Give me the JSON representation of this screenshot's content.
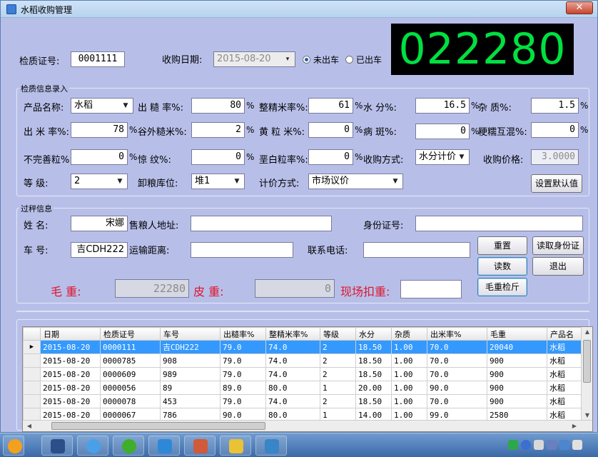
{
  "window": {
    "title": "水稻收购管理",
    "close_label": "✕"
  },
  "header": {
    "cert_label": "检质证号:",
    "cert_value": "0001111",
    "date_label": "收购日期:",
    "date_value": "2015-08-20",
    "radio_unshipped": "未出车",
    "radio_shipped": "已出车",
    "big_display": "022280"
  },
  "quality": {
    "group_title": "检质信息录入",
    "product_label": "产品名称:",
    "product_value": "水稻",
    "chucao_label": "出 糙 率%:",
    "chucao_value": "80",
    "zhengjing_label": "整精米率%:",
    "zhengjing_value": "61",
    "shuifen_label": "水     分%:",
    "shuifen_value": "16.5",
    "zazhi_label": "杂     质%:",
    "zazhi_value": "1.5",
    "chumi_label": "出 米 率%:",
    "chumi_value": "78",
    "guwai_label": "谷外糙米%:",
    "guwai_value": "2",
    "huangli_label": "黄 粒 米%:",
    "huangli_value": "0",
    "bingban_label": "病     斑%:",
    "bingban_value": "0",
    "genghun_label": "粳糯互混%:",
    "genghun_value": "0",
    "buwanshan_label": "不完善粒%:",
    "buwanshan_value": "0",
    "jingwen_label": "惊     纹%:",
    "jingwen_value": "0",
    "ebai_label": "垩白粒率%:",
    "ebai_value": "0",
    "method_label": "收购方式:",
    "method_value": "水分计价",
    "price_label": "收购价格:",
    "price_value": "3.0000",
    "grade_label": "等     级:",
    "grade_value": "2",
    "unload_label": "卸粮库位:",
    "unload_value": "堆1",
    "pricing_label": "计价方式:",
    "pricing_value": "市场议价",
    "default_button": "设置默认值",
    "percent": "%"
  },
  "weigh": {
    "group_title": "过秤信息",
    "name_label": "姓     名:",
    "name_value": "宋娜",
    "address_label": "售粮人地址:",
    "address_value": "",
    "id_label": "身份证号:",
    "id_value": "",
    "plate_label": "车     号:",
    "plate_value": "吉CDH222",
    "distance_label": "运输距离:",
    "distance_value": "",
    "phone_label": "联系电话:",
    "phone_value": "",
    "reset_button": "重置",
    "read_id_button": "读取身份证",
    "read_button": "读数",
    "exit_button": "退出",
    "gross_label": "毛     重:",
    "gross_value": "22280",
    "tare_label": "皮     重:",
    "tare_value": "0",
    "deduct_label": "现场扣重:",
    "deduct_value": "",
    "gross_check_button": "毛重检斤"
  },
  "grid": {
    "columns": [
      "日期",
      "检质证号",
      "车号",
      "出糙率%",
      "整精米率%",
      "等级",
      "水分",
      "杂质",
      "出米率%",
      "毛重",
      "产品名"
    ],
    "rows": [
      [
        "2015-08-20",
        "0000111",
        "吉CDH222",
        "79.0",
        "74.0",
        "2",
        "18.50",
        "1.00",
        "70.0",
        "20040",
        "水稻"
      ],
      [
        "2015-08-20",
        "0000785",
        "908",
        "79.0",
        "74.0",
        "2",
        "18.50",
        "1.00",
        "70.0",
        "900",
        "水稻"
      ],
      [
        "2015-08-20",
        "0000609",
        "989",
        "79.0",
        "74.0",
        "2",
        "18.50",
        "1.00",
        "70.0",
        "900",
        "水稻"
      ],
      [
        "2015-08-20",
        "0000056",
        "89",
        "89.0",
        "80.0",
        "1",
        "20.00",
        "1.00",
        "90.0",
        "900",
        "水稻"
      ],
      [
        "2015-08-20",
        "0000078",
        "453",
        "79.0",
        "74.0",
        "2",
        "18.50",
        "1.00",
        "70.0",
        "900",
        "水稻"
      ],
      [
        "2015-08-20",
        "0000067",
        "786",
        "90.0",
        "80.0",
        "1",
        "14.00",
        "1.00",
        "99.0",
        "2580",
        "水稻"
      ]
    ]
  },
  "colors": {
    "accent_red": "#e0152a",
    "display_green": "#00e040",
    "selection": "#3399ff"
  }
}
